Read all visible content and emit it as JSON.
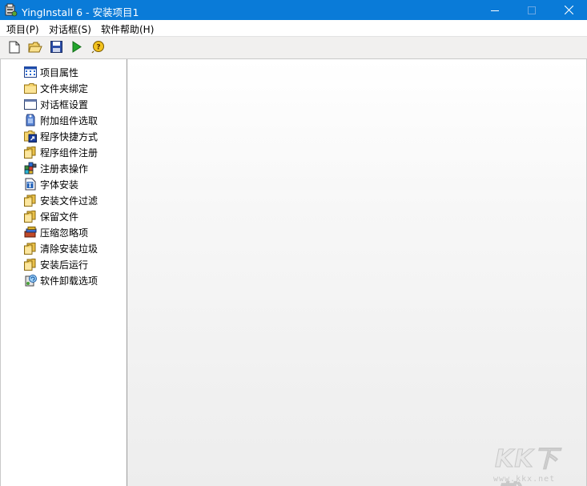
{
  "window": {
    "title": "YingInstall 6 - 安装项目1",
    "titlebar_color": "#0a7bd8"
  },
  "menu": [
    {
      "label": "项目(P)"
    },
    {
      "label": "对话框(S)"
    },
    {
      "label": "软件帮助(H)"
    }
  ],
  "toolbar": [
    {
      "icon": "new-file-icon"
    },
    {
      "icon": "open-folder-icon"
    },
    {
      "icon": "save-icon"
    },
    {
      "icon": "run-play-icon"
    },
    {
      "icon": "help-icon"
    }
  ],
  "nav": [
    {
      "label": "项目属性",
      "icon": "project-properties-icon"
    },
    {
      "label": "文件夹绑定",
      "icon": "folder-icon"
    },
    {
      "label": "对话框设置",
      "icon": "dialog-window-icon"
    },
    {
      "label": "附加组件选取",
      "icon": "component-icon"
    },
    {
      "label": "程序快捷方式",
      "icon": "shortcut-icon"
    },
    {
      "label": "程序组件注册",
      "icon": "folders-icon"
    },
    {
      "label": "注册表操作",
      "icon": "registry-icon"
    },
    {
      "label": "字体安装",
      "icon": "font-icon"
    },
    {
      "label": "安装文件过滤",
      "icon": "folders-icon"
    },
    {
      "label": "保留文件",
      "icon": "folders-icon"
    },
    {
      "label": "压缩忽略项",
      "icon": "compress-icon"
    },
    {
      "label": "清除安装垃圾",
      "icon": "folders-icon"
    },
    {
      "label": "安装后运行",
      "icon": "folders-icon"
    },
    {
      "label": "软件卸载选项",
      "icon": "uninstall-icon"
    }
  ],
  "watermark": {
    "logo_text": "KK下载",
    "url": "www.kkx.net"
  }
}
